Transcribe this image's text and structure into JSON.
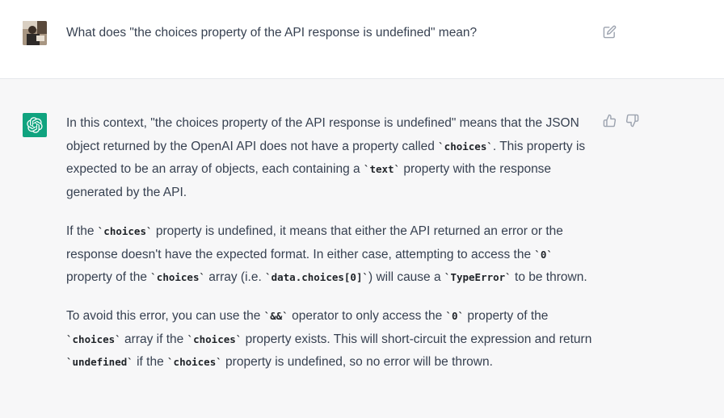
{
  "user_message": {
    "text": "What does \"the choices property of the API response is undefined\" mean?",
    "avatar_icon": "user-photo",
    "edit_icon": "edit-icon"
  },
  "assistant_message": {
    "avatar_icon": "openai-logo-icon",
    "accent_color": "#10a37f",
    "paragraphs": [
      [
        {
          "t": "In this context, \"the choices property of the API response is undefined\" means that the JSON object returned by the OpenAI API does not have a property called "
        },
        {
          "c": "`choices`"
        },
        {
          "t": ". This property is expected to be an array of objects, each containing a "
        },
        {
          "c": "`text`"
        },
        {
          "t": " property with the response generated by the API."
        }
      ],
      [
        {
          "t": "If the "
        },
        {
          "c": "`choices`"
        },
        {
          "t": " property is undefined, it means that either the API returned an error or the response doesn't have the expected format. In either case, attempting to access the "
        },
        {
          "c": "`0`"
        },
        {
          "t": " property of the "
        },
        {
          "c": "`choices`"
        },
        {
          "t": " array (i.e. "
        },
        {
          "c": "`data.choices[0]`"
        },
        {
          "t": ") will cause a "
        },
        {
          "c": "`TypeError`"
        },
        {
          "t": " to be thrown."
        }
      ],
      [
        {
          "t": "To avoid this error, you can use the "
        },
        {
          "c": "`&&`"
        },
        {
          "t": " operator to only access the "
        },
        {
          "c": "`0`"
        },
        {
          "t": " property of the "
        },
        {
          "c": "`choices`"
        },
        {
          "t": " array if the "
        },
        {
          "c": "`choices`"
        },
        {
          "t": " property exists. This will short-circuit the expression and return "
        },
        {
          "c": "`undefined`"
        },
        {
          "t": " if the "
        },
        {
          "c": "`choices`"
        },
        {
          "t": " property is undefined, so no error will be thrown."
        }
      ]
    ],
    "feedback": {
      "thumbs_up_icon": "thumbs-up-icon",
      "thumbs_down_icon": "thumbs-down-icon"
    }
  }
}
